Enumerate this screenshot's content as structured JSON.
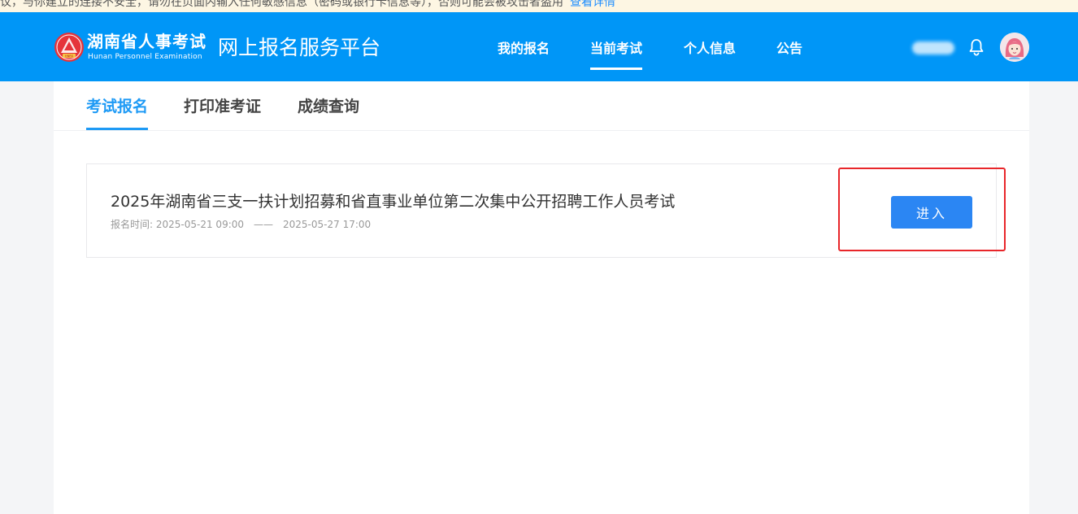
{
  "notice": {
    "text": "议，与你建立的连接不安全，请勿在页面内输入任何敏感信息（密码或银行卡信息等），否则可能会被攻击者盗用",
    "link": "查看详情"
  },
  "header": {
    "logo_title": "湖南省人事考试",
    "logo_subtitle": "Hunan Personnel Examination",
    "logo_badge": "HNRS",
    "platform_name": "网上报名服务平台",
    "nav": [
      {
        "label": "我的报名",
        "active": false
      },
      {
        "label": "当前考试",
        "active": true
      },
      {
        "label": "个人信息",
        "active": false
      },
      {
        "label": "公告",
        "active": false
      }
    ],
    "user_name": "用户",
    "colors": {
      "bar": "#0096f7",
      "logo": "#e5343a"
    }
  },
  "tabs": [
    {
      "label": "考试报名",
      "active": true
    },
    {
      "label": "打印准考证",
      "active": false
    },
    {
      "label": "成绩查询",
      "active": false
    }
  ],
  "exam": {
    "title": "2025年湖南省三支一扶计划招募和省直事业单位第二次集中公开招聘工作人员考试",
    "time_label": "报名时间:",
    "start": "2025-05-21 09:00",
    "separator": "——",
    "end": "2025-05-27 17:00",
    "button_label": "进入"
  },
  "icons": {
    "bell": "bell-icon",
    "avatar": "avatar-icon",
    "logo": "emblem-logo-icon"
  }
}
